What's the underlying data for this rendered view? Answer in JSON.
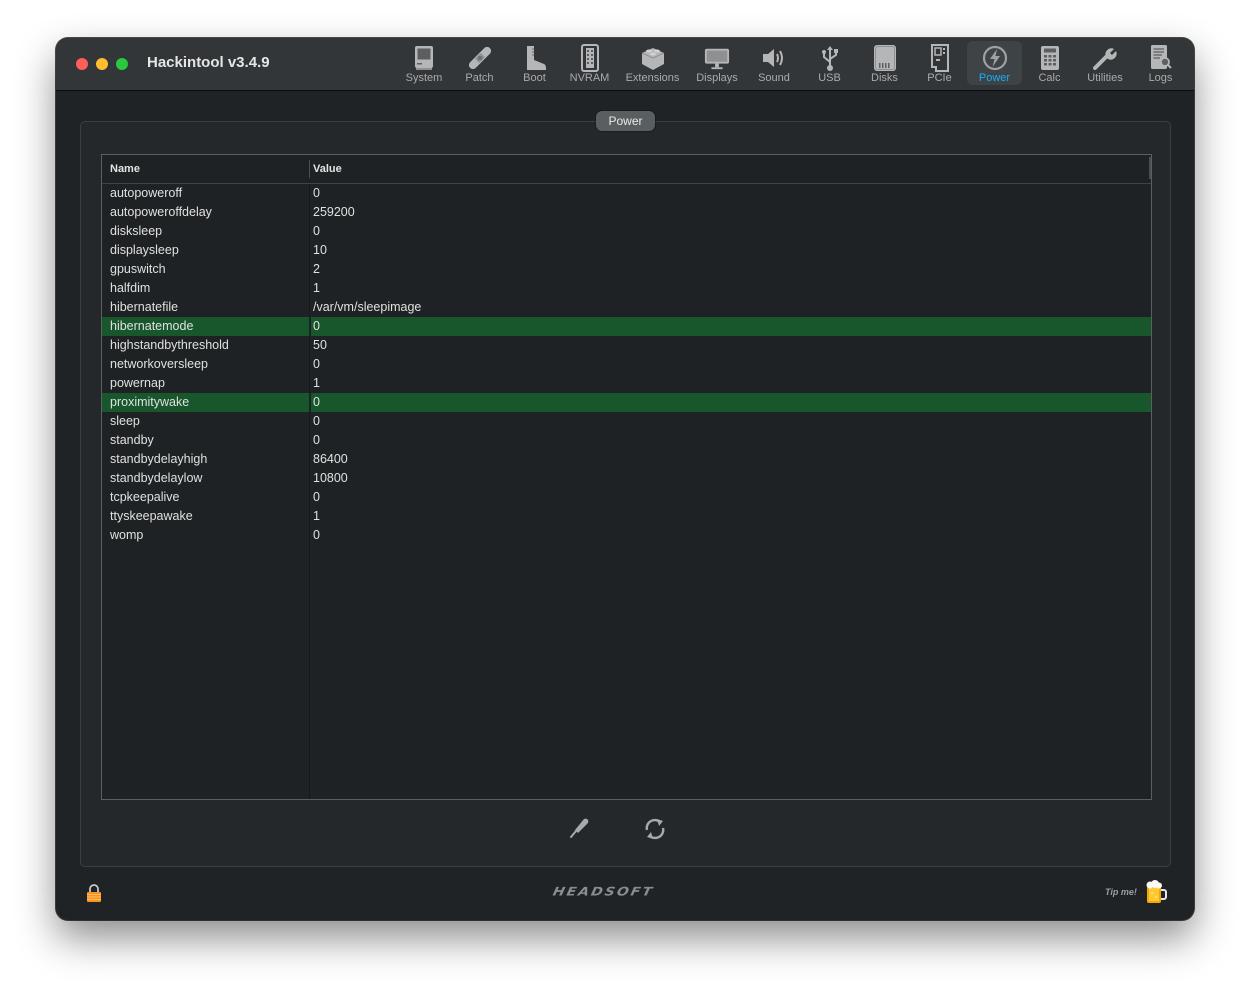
{
  "window": {
    "title": "Hackintool v3.4.9"
  },
  "toolbar": {
    "active": "Power",
    "items": [
      {
        "label": "System",
        "icon": "computer-icon"
      },
      {
        "label": "Patch",
        "icon": "bandage-icon"
      },
      {
        "label": "Boot",
        "icon": "boot-icon"
      },
      {
        "label": "NVRAM",
        "icon": "memory-icon"
      },
      {
        "label": "Extensions",
        "icon": "lego-brick-icon"
      },
      {
        "label": "Displays",
        "icon": "display-icon"
      },
      {
        "label": "Sound",
        "icon": "speaker-icon"
      },
      {
        "label": "USB",
        "icon": "usb-icon"
      },
      {
        "label": "Disks",
        "icon": "disk-icon"
      },
      {
        "label": "PCIe",
        "icon": "pcie-card-icon"
      },
      {
        "label": "Power",
        "icon": "power-bolt-icon"
      },
      {
        "label": "Calc",
        "icon": "calculator-icon"
      },
      {
        "label": "Utilities",
        "icon": "wrench-icon"
      },
      {
        "label": "Logs",
        "icon": "log-search-icon"
      }
    ]
  },
  "panel": {
    "tab_label": "Power",
    "table": {
      "columns": [
        "Name",
        "Value"
      ],
      "rows": [
        {
          "name": "autopoweroff",
          "value": "0",
          "selected": false
        },
        {
          "name": "autopoweroffdelay",
          "value": "259200",
          "selected": false
        },
        {
          "name": "disksleep",
          "value": "0",
          "selected": false
        },
        {
          "name": "displaysleep",
          "value": "10",
          "selected": false
        },
        {
          "name": "gpuswitch",
          "value": "2",
          "selected": false
        },
        {
          "name": "halfdim",
          "value": "1",
          "selected": false
        },
        {
          "name": "hibernatefile",
          "value": "/var/vm/sleepimage",
          "selected": false
        },
        {
          "name": "hibernatemode",
          "value": "0",
          "selected": true
        },
        {
          "name": "highstandbythreshold",
          "value": "50",
          "selected": false
        },
        {
          "name": "networkoversleep",
          "value": "0",
          "selected": false
        },
        {
          "name": "powernap",
          "value": "1",
          "selected": false
        },
        {
          "name": "proximitywake",
          "value": "0",
          "selected": true
        },
        {
          "name": "sleep",
          "value": "0",
          "selected": false
        },
        {
          "name": "standby",
          "value": "0",
          "selected": false
        },
        {
          "name": "standbydelayhigh",
          "value": "86400",
          "selected": false
        },
        {
          "name": "standbydelaylow",
          "value": "10800",
          "selected": false
        },
        {
          "name": "tcpkeepalive",
          "value": "0",
          "selected": false
        },
        {
          "name": "ttyskeepawake",
          "value": "1",
          "selected": false
        },
        {
          "name": "womp",
          "value": "0",
          "selected": false
        }
      ]
    },
    "actions": [
      {
        "name": "edit",
        "icon": "pencil-icon"
      },
      {
        "name": "refresh",
        "icon": "refresh-icon"
      }
    ]
  },
  "footer": {
    "lock_icon": "lock-icon",
    "brand": "HEADSOFT",
    "tip_label": "Tip me!",
    "tip_icon": "beer-mug-icon"
  },
  "colors": {
    "accent": "#1badf8",
    "selection": "#17572b",
    "window_bg": "#1f2326",
    "titlebar_bg": "#323638"
  }
}
